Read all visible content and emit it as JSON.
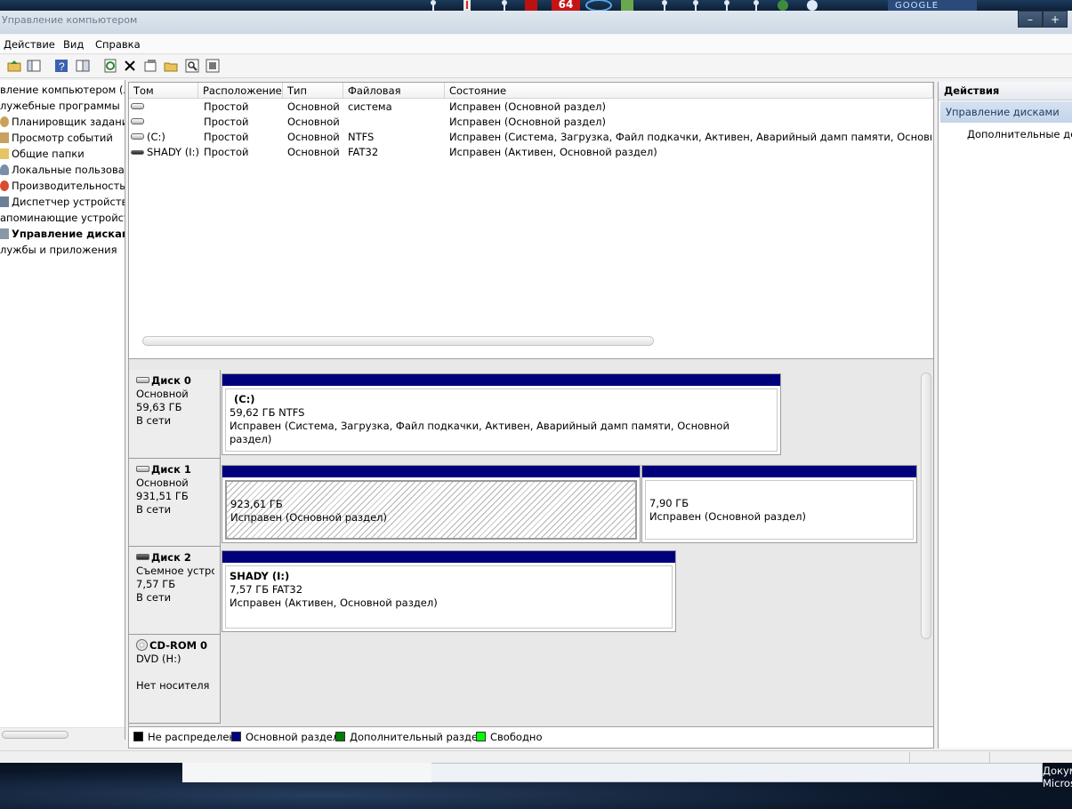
{
  "window": {
    "title": "Управление компьютером",
    "minimize_glyph": "–",
    "maximize_glyph": "+",
    "taskbar_brand": "GOOGLE",
    "taskbar_cpu_temp": "64"
  },
  "menu": {
    "items": [
      "Действие",
      "Вид",
      "Справка"
    ]
  },
  "toolbar": {
    "icons": [
      "folder-up-icon",
      "console-tree-icon",
      "help-icon",
      "properties-icon",
      "refresh-icon",
      "delete-icon",
      "properties-sheet-icon",
      "open-icon",
      "find-icon",
      "settings-icon"
    ]
  },
  "nav": {
    "items": [
      {
        "label": "вление компьютером (ло",
        "icon": "computer-management-icon"
      },
      {
        "label": "лужебные программы",
        "icon": "system-tools-icon"
      },
      {
        "label": "Планировщик заданий",
        "icon": "task-scheduler-icon"
      },
      {
        "label": "Просмотр событий",
        "icon": "event-viewer-icon"
      },
      {
        "label": "Общие папки",
        "icon": "shared-folders-icon"
      },
      {
        "label": "Локальные пользовате",
        "icon": "local-users-icon"
      },
      {
        "label": "Производительность",
        "icon": "performance-icon"
      },
      {
        "label": "Диспетчер устройств",
        "icon": "device-manager-icon"
      },
      {
        "label": "апоминающие устройства",
        "icon": "storage-icon"
      },
      {
        "label": "Управление дисками",
        "icon": "disk-management-icon"
      },
      {
        "label": "лужбы и приложения",
        "icon": "services-icon"
      }
    ]
  },
  "volumes": {
    "columns": [
      "Том",
      "Расположение",
      "Тип",
      "Файловая система",
      "Состояние"
    ],
    "rows": [
      {
        "name": "",
        "layout": "Простой",
        "type": "Основной",
        "fs": "",
        "status": "Исправен (Основной раздел)",
        "icon": "disk-icon"
      },
      {
        "name": "",
        "layout": "Простой",
        "type": "Основной",
        "fs": "",
        "status": "Исправен (Основной раздел)",
        "icon": "disk-icon"
      },
      {
        "name": "(C:)",
        "layout": "Простой",
        "type": "Основной",
        "fs": "NTFS",
        "status": "Исправен (Система, Загрузка, Файл подкачки, Активен, Аварийный дамп памяти, Основной разде",
        "icon": "disk-icon"
      },
      {
        "name": "SHADY (I:)",
        "layout": "Простой",
        "type": "Основной",
        "fs": "FAT32",
        "status": "Исправен (Активен, Основной раздел)",
        "icon": "removable-disk-icon"
      }
    ]
  },
  "disks": [
    {
      "name": "Диск 0",
      "kind": "Основной",
      "size": "59,63 ГБ",
      "state": "В сети",
      "partitions": [
        {
          "title": "(C:)",
          "size": "59,62 ГБ NTFS",
          "status": "Исправен (Система, Загрузка, Файл подкачки, Активен, Аварийный дамп памяти, Основной раздел)"
        }
      ]
    },
    {
      "name": "Диск 1",
      "kind": "Основной",
      "size": "931,51 ГБ",
      "state": "В сети",
      "partitions": [
        {
          "title": "",
          "size": "923,61 ГБ",
          "status": "Исправен (Основной раздел)"
        },
        {
          "title": "",
          "size": "7,90 ГБ",
          "status": "Исправен (Основной раздел)"
        }
      ]
    },
    {
      "name": "Диск 2",
      "kind": "Съемное устро",
      "size": "7,57 ГБ",
      "state": "В сети",
      "partitions": [
        {
          "title": "SHADY  (I:)",
          "size": "7,57 ГБ FAT32",
          "status": "Исправен (Активен, Основной раздел)"
        }
      ]
    },
    {
      "name": "CD-ROM 0",
      "kind": "DVD (H:)",
      "size": "",
      "state": "Нет носителя",
      "partitions": []
    }
  ],
  "legend": [
    {
      "label": "Не распределен",
      "color": "#000000"
    },
    {
      "label": "Основной раздел",
      "color": "#00007d"
    },
    {
      "label": "Дополнительный раздел",
      "color": "#007d00"
    },
    {
      "label": "Свободно",
      "color": "#00ff00"
    }
  ],
  "actions": {
    "title": "Действия",
    "group": "Управление дисками",
    "more": "Дополнительные дей"
  },
  "desktop": {
    "doc_label_1": "Докум",
    "doc_label_2": "Micros"
  }
}
